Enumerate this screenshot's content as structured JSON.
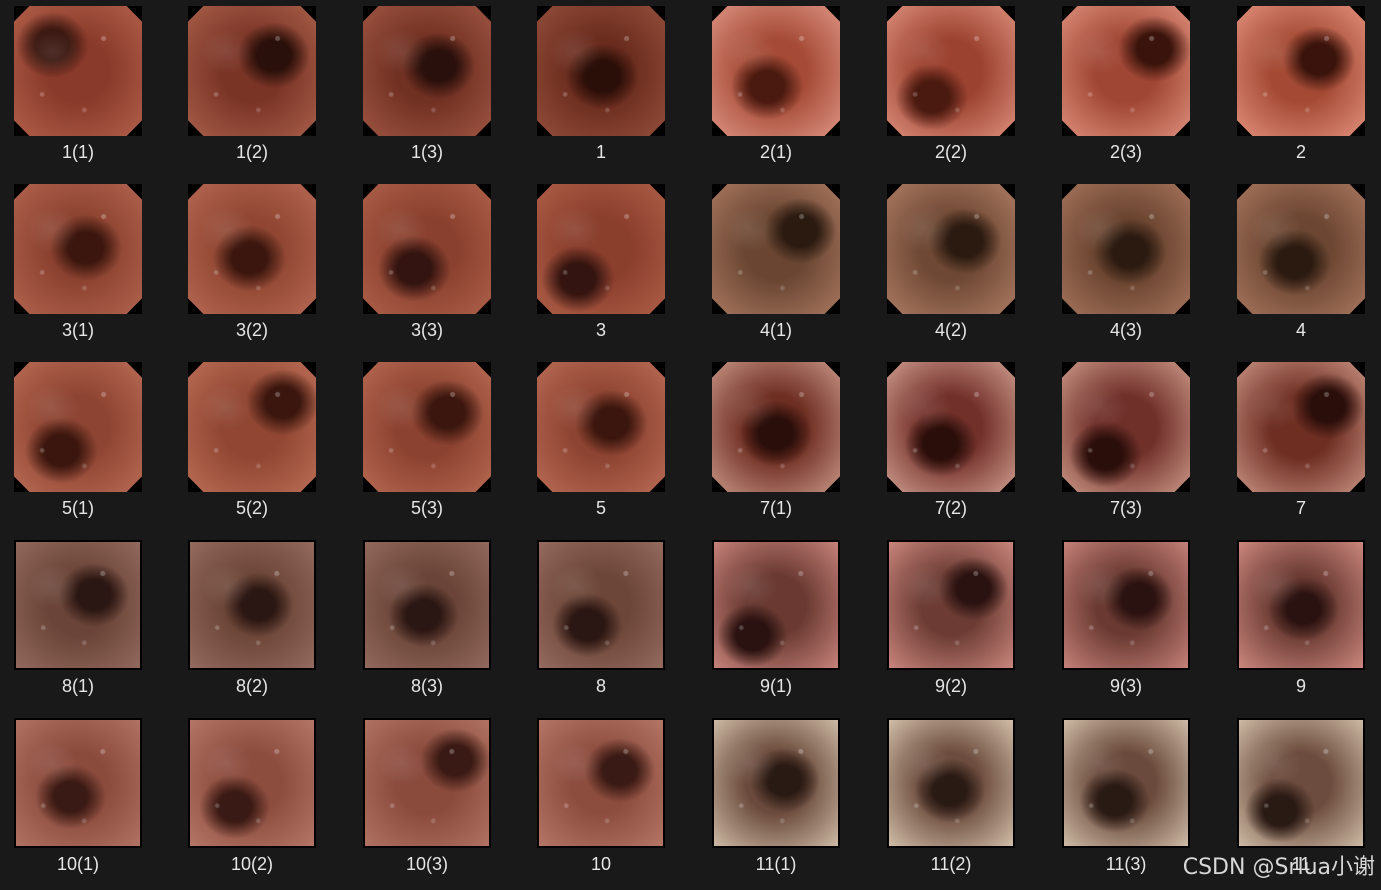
{
  "files": [
    {
      "label": "1(1)",
      "shape": "oct",
      "colors": [
        "#3a1710",
        "#8a3a2a",
        "#b86650"
      ]
    },
    {
      "label": "1(2)",
      "shape": "oct",
      "colors": [
        "#2a100a",
        "#7a3426",
        "#b06650"
      ]
    },
    {
      "label": "1(3)",
      "shape": "oct",
      "colors": [
        "#2a100c",
        "#703022",
        "#a85c48"
      ]
    },
    {
      "label": "1",
      "shape": "oct",
      "colors": [
        "#2a0e08",
        "#6a2c1e",
        "#9c5440"
      ]
    },
    {
      "label": "2(1)",
      "shape": "oct",
      "colors": [
        "#4a1a10",
        "#a44a36",
        "#e8a090"
      ]
    },
    {
      "label": "2(2)",
      "shape": "oct",
      "colors": [
        "#4a1a10",
        "#9c4230",
        "#e89c8a"
      ]
    },
    {
      "label": "2(3)",
      "shape": "oct",
      "colors": [
        "#3a140c",
        "#a04634",
        "#e89c88"
      ]
    },
    {
      "label": "2",
      "shape": "oct",
      "colors": [
        "#3a140c",
        "#a44a34",
        "#ec9c88"
      ]
    },
    {
      "label": "3(1)",
      "shape": "oct",
      "colors": [
        "#3a160e",
        "#8c4230",
        "#b86a54"
      ]
    },
    {
      "label": "3(2)",
      "shape": "oct",
      "colors": [
        "#3a160e",
        "#904632",
        "#bc6e58"
      ]
    },
    {
      "label": "3(3)",
      "shape": "oct",
      "colors": [
        "#341410",
        "#8a402e",
        "#b4664e"
      ]
    },
    {
      "label": "3",
      "shape": "oct",
      "colors": [
        "#341410",
        "#8a3e2c",
        "#b4644c"
      ]
    },
    {
      "label": "4(1)",
      "shape": "oct",
      "colors": [
        "#2a1a10",
        "#6a4632",
        "#b48068"
      ]
    },
    {
      "label": "4(2)",
      "shape": "oct",
      "colors": [
        "#2a1a10",
        "#6e4834",
        "#b8846c"
      ]
    },
    {
      "label": "4(3)",
      "shape": "oct",
      "colors": [
        "#2a1a10",
        "#6a4430",
        "#b07c64"
      ]
    },
    {
      "label": "4",
      "shape": "oct",
      "colors": [
        "#2a1a10",
        "#6c4632",
        "#b27e66"
      ]
    },
    {
      "label": "5(1)",
      "shape": "oct",
      "colors": [
        "#3a160e",
        "#8e4432",
        "#c0725a"
      ]
    },
    {
      "label": "5(2)",
      "shape": "oct",
      "colors": [
        "#3a160e",
        "#904632",
        "#c2745c"
      ]
    },
    {
      "label": "5(3)",
      "shape": "oct",
      "colors": [
        "#3a160e",
        "#8c4230",
        "#be7058"
      ]
    },
    {
      "label": "5",
      "shape": "oct",
      "colors": [
        "#3a160e",
        "#8e4432",
        "#c0725a"
      ]
    },
    {
      "label": "7(1)",
      "shape": "oct",
      "colors": [
        "#2a0e0a",
        "#6e2e22",
        "#d8a898"
      ]
    },
    {
      "label": "7(2)",
      "shape": "oct",
      "colors": [
        "#2a0e0a",
        "#72302a",
        "#e0b0a0"
      ]
    },
    {
      "label": "7(3)",
      "shape": "oct",
      "colors": [
        "#2a0e0a",
        "#70302a",
        "#dcaa98"
      ]
    },
    {
      "label": "7",
      "shape": "oct",
      "colors": [
        "#2a0e0a",
        "#6e2e22",
        "#d8a494"
      ]
    },
    {
      "label": "8(1)",
      "shape": "rect",
      "colors": [
        "#2a1612",
        "#6a4438",
        "#9a7064"
      ]
    },
    {
      "label": "8(2)",
      "shape": "rect",
      "colors": [
        "#2a1612",
        "#6c4638",
        "#9c7266"
      ]
    },
    {
      "label": "8(3)",
      "shape": "rect",
      "colors": [
        "#2a1612",
        "#6a4438",
        "#9a7064"
      ]
    },
    {
      "label": "8",
      "shape": "rect",
      "colors": [
        "#2a1612",
        "#6c4638",
        "#9c7266"
      ]
    },
    {
      "label": "9(1)",
      "shape": "rect",
      "colors": [
        "#2a1210",
        "#6a3a32",
        "#d89088"
      ]
    },
    {
      "label": "9(2)",
      "shape": "rect",
      "colors": [
        "#2a1210",
        "#6c3c34",
        "#dc948a"
      ]
    },
    {
      "label": "9(3)",
      "shape": "rect",
      "colors": [
        "#2a1210",
        "#6a3a32",
        "#d68e86"
      ]
    },
    {
      "label": "9",
      "shape": "rect",
      "colors": [
        "#2a1210",
        "#6c3c34",
        "#de968c"
      ]
    },
    {
      "label": "10(1)",
      "shape": "rect",
      "colors": [
        "#3a1a14",
        "#8a4a3c",
        "#b87a6a"
      ]
    },
    {
      "label": "10(2)",
      "shape": "rect",
      "colors": [
        "#3a1a14",
        "#8c4c3e",
        "#bc7e6e"
      ]
    },
    {
      "label": "10(3)",
      "shape": "rect",
      "colors": [
        "#3a1a14",
        "#8a4a3c",
        "#b87a6a"
      ]
    },
    {
      "label": "10",
      "shape": "rect",
      "colors": [
        "#3a1a14",
        "#8c4c3e",
        "#bc7e6e"
      ]
    },
    {
      "label": "11(1)",
      "shape": "rect",
      "colors": [
        "#2a1a14",
        "#6a4a3c",
        "#e0d0b8"
      ]
    },
    {
      "label": "11(2)",
      "shape": "rect",
      "colors": [
        "#2a1a14",
        "#6c4c3e",
        "#e4d4bc"
      ]
    },
    {
      "label": "11(3)",
      "shape": "rect",
      "colors": [
        "#2a1a14",
        "#6a4a3c",
        "#e2d2ba"
      ]
    },
    {
      "label": "11",
      "shape": "rect",
      "colors": [
        "#2a1a14",
        "#6c4c3e",
        "#e0d0b8"
      ]
    }
  ],
  "watermark": "CSDN @Srlua小谢"
}
